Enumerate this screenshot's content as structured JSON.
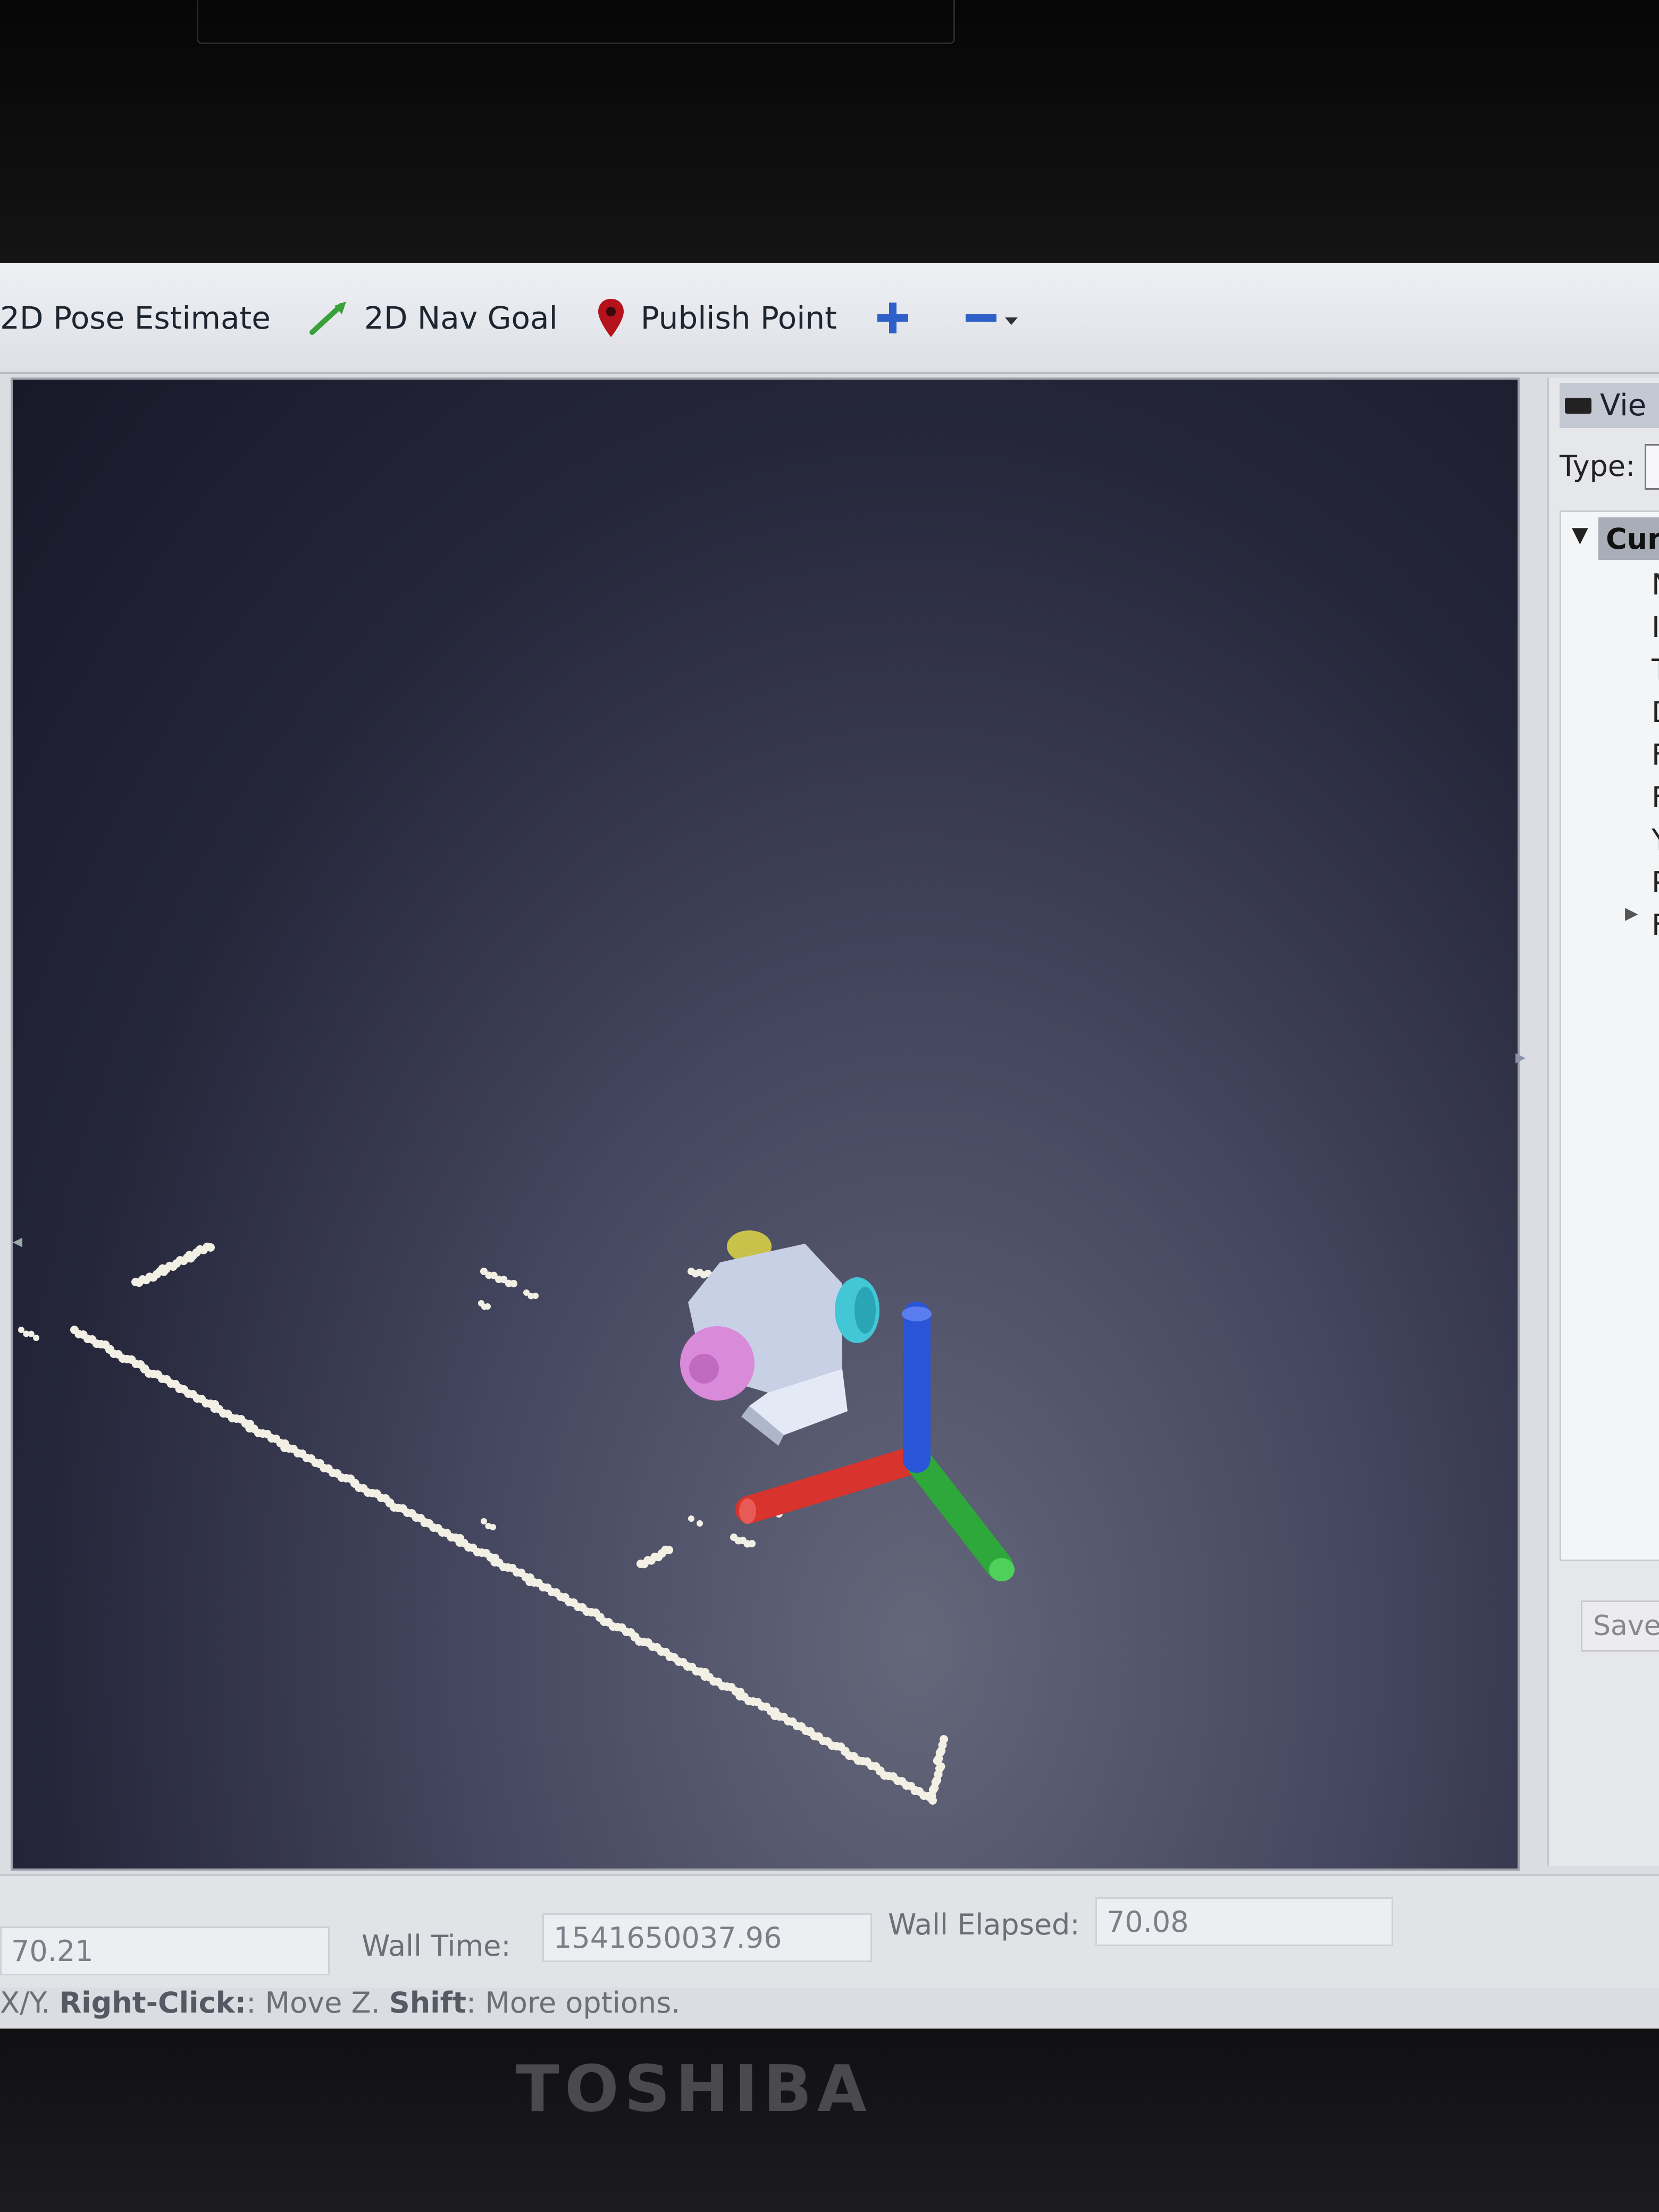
{
  "toolbar": {
    "pose_estimate_label": "2D Pose Estimate",
    "nav_goal_label": "2D Nav Goal",
    "publish_point_label": "Publish Point"
  },
  "views_panel": {
    "title": "Vie",
    "type_label": "Type:",
    "current_item": "Cur",
    "fields": [
      "N",
      "I",
      "T",
      "D",
      "F",
      "F",
      "Y",
      "P",
      "F"
    ],
    "save_label": "Save"
  },
  "status": {
    "ros_elapsed_value": "70.21",
    "wall_time_label": "Wall Time:",
    "wall_time_value": "1541650037.96",
    "wall_elapsed_label": "Wall Elapsed:",
    "wall_elapsed_value": "70.08"
  },
  "hint": {
    "prefix": "X/Y. ",
    "right_click": "Right-Click:",
    "move_z": ": Move Z. ",
    "shift": "Shift",
    "more": ": More options."
  },
  "laptop_brand": "TOSHIBA",
  "colors": {
    "axis_x": "#d9332e",
    "axis_y": "#2ea83a",
    "axis_z": "#2a55d8",
    "robot_body": "#c8d0e6",
    "wheel_left": "#d98ad9",
    "wheel_right": "#43c6d6",
    "caster": "#c9c24a",
    "laser_scan": "#f2efe4"
  }
}
